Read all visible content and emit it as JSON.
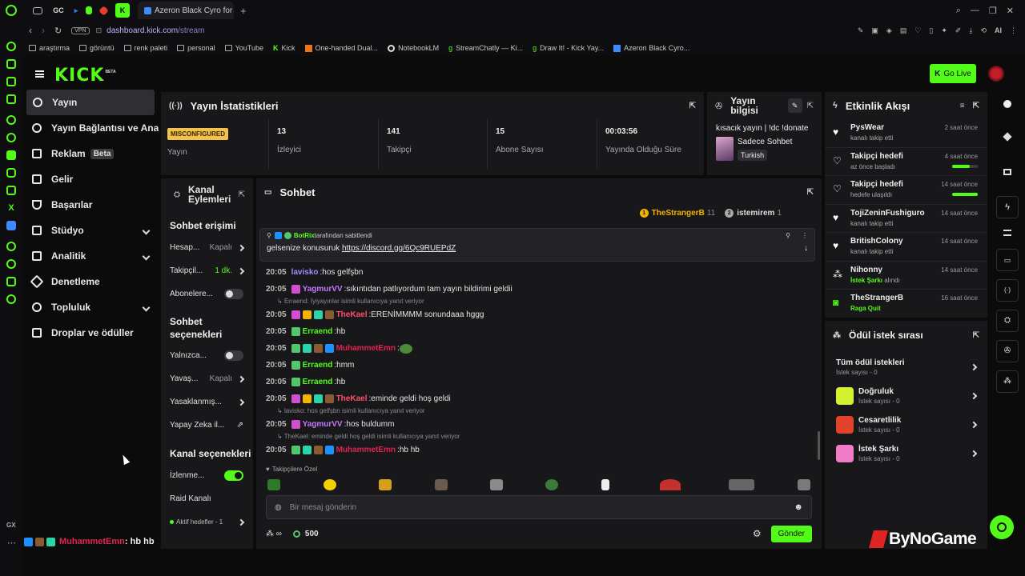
{
  "browser": {
    "tab_title": "Azeron Black Cyro for Lefti",
    "tab_labels": [
      "GC"
    ],
    "vpn": "VPN",
    "url_host": "dashboard.kick.com",
    "url_path": "/stream",
    "ai_label": "AI",
    "bookmarks": [
      "araştırma",
      "görüntü",
      "renk paleti",
      "personal",
      "YouTube",
      "Kick",
      "One-handed Dual...",
      "NotebookLM",
      "StreamChatly — Ki...",
      "Draw It! - Kick Yay...",
      "Azeron Black Cyro..."
    ],
    "gx_label": "GX"
  },
  "header": {
    "logo": "KICK",
    "logo_tag": "BETA",
    "go_live": "Go Live"
  },
  "nav": {
    "items": [
      {
        "label": "Yayın"
      },
      {
        "label": "Yayın Bağlantısı ve Anahtar"
      },
      {
        "label": "Reklam",
        "badge": "Beta"
      },
      {
        "label": "Gelir"
      },
      {
        "label": "Başarılar"
      },
      {
        "label": "Stüdyo"
      },
      {
        "label": "Analitik"
      },
      {
        "label": "Denetleme"
      },
      {
        "label": "Topluluk"
      },
      {
        "label": "Droplar ve ödüller"
      }
    ]
  },
  "stats": {
    "title": "Yayın İstatistikleri",
    "status_badge": "MISCONFIGURED",
    "status_label": "Yayın",
    "cells": [
      {
        "value": "13",
        "label": "İzleyici"
      },
      {
        "value": "141",
        "label": "Takipçi"
      },
      {
        "value": "15",
        "label": "Abone Sayısı"
      },
      {
        "value": "00:03:56",
        "label": "Yayında Olduğu Süre"
      }
    ]
  },
  "info": {
    "title_line1": "Yayın",
    "title_line2": "bilgisi",
    "stream_title": "kısacık yayın | !dc !donate",
    "category": "Sadece Sohbet",
    "language": "Turkish"
  },
  "events": {
    "title": "Etkinlik Akışı",
    "items": [
      {
        "name": "PysWear",
        "desc": "kanalı takip etti",
        "time": "2 saat önce"
      },
      {
        "name": "Takipçi hedefi",
        "desc": "az önce başladı",
        "time": "4 saat önce",
        "progress": 0.7
      },
      {
        "name": "Takipçi hedefi",
        "desc": "hedefe ulaşıldı",
        "time": "14 saat önce",
        "progress": 1.0
      },
      {
        "name": "TojiZeninFushiguro",
        "desc": "kanalı takip etti",
        "time": "14 saat önce"
      },
      {
        "name": "BritishColony",
        "desc": "kanalı takip etti",
        "time": "14 saat önce"
      },
      {
        "name": "Nihonny",
        "desc_highlight": "İstek Şarkı",
        "desc": " alındı",
        "time": "14 saat önce"
      },
      {
        "name": "TheStrangerB",
        "desc": "Raga Quit",
        "time": "16 saat önce"
      }
    ]
  },
  "actions": {
    "title_line1": "Kanal",
    "title_line2": "Eylemleri",
    "chat_access": "Sohbet erişimi",
    "row1": {
      "label": "Hesap...",
      "value": "Kapalı"
    },
    "row2": {
      "label": "Takipçil...",
      "value": "1 dk."
    },
    "row3": {
      "label": "Abonelere..."
    },
    "chat_options_line1": "Sohbet",
    "chat_options_line2": "seçenekleri",
    "row4": {
      "label": "Yalnızca..."
    },
    "row5": {
      "label": "Yavaş...",
      "value": "Kapalı"
    },
    "row6": {
      "label": "Yasaklanmış..."
    },
    "row7": {
      "label": "Yapay Zeka il..."
    },
    "channel_options": "Kanal seçenekleri",
    "row8": {
      "label": "İzlenme..."
    },
    "row9": {
      "label": "Raid Kanalı"
    },
    "row10": {
      "label": "Aktif hedefler - 1"
    }
  },
  "chat": {
    "title": "Sohbet",
    "top_users": [
      {
        "rank": "1",
        "name": "TheStrangerB",
        "count": "11"
      },
      {
        "rank": "2",
        "name": "istemirem",
        "count": "1"
      }
    ],
    "pinned": {
      "by": "BotRix",
      "by_suffix": " tarafından sabitlendi",
      "text": "gelsenize konusuruk ",
      "link": "https://discord.gg/6Qc9RUEPdZ"
    },
    "messages": [
      {
        "time": "20:05",
        "user": "lavisko",
        "color": "#9f8cff",
        "text": "hos gelfşbn",
        "badges": []
      },
      {
        "time": "20:05",
        "user": "YagmurVV",
        "color": "#c477ff",
        "text": "sıkıntıdan patlıyordum tam yayın bildirimi geldii",
        "badges": [
          "#d04fd0"
        ]
      },
      {
        "reply": "Erraend: İyiyayınlar isimli kullanıcıya yanıt veriyor"
      },
      {
        "time": "20:05",
        "user": "TheKael",
        "color": "#ff4f6b",
        "text": "ERENİMMMM sonundaaa hggg",
        "badges": [
          "#d04fd0",
          "#f2b400",
          "#2bd4a6",
          "#8a5a30"
        ]
      },
      {
        "time": "20:05",
        "user": "Erraend",
        "color": "#53fc18",
        "text": "hb",
        "badges": [
          "#53c66b"
        ]
      },
      {
        "time": "20:05",
        "user": "MuhammetEmn",
        "color": "#e0244f",
        "text": "",
        "badges": [
          "#53c66b",
          "#2bd4a6",
          "#8a5a30",
          "#1e90ff"
        ]
      },
      {
        "time": "20:05",
        "user": "Erraend",
        "color": "#53fc18",
        "text": "hmm",
        "badges": [
          "#53c66b"
        ]
      },
      {
        "time": "20:05",
        "user": "Erraend",
        "color": "#53fc18",
        "text": "hb",
        "badges": [
          "#53c66b"
        ]
      },
      {
        "time": "20:05",
        "user": "TheKael",
        "color": "#ff4f6b",
        "text": "eminde geldi hoş geldi",
        "badges": [
          "#d04fd0",
          "#f2b400",
          "#2bd4a6",
          "#8a5a30"
        ]
      },
      {
        "reply": "lavisko: hos gelfşbn isimli kullanıcıya yanıt veriyor"
      },
      {
        "time": "20:05",
        "user": "YagmurVV",
        "color": "#c477ff",
        "text": "hos buldumm",
        "badges": [
          "#d04fd0"
        ]
      },
      {
        "reply": "TheKael: eminde geldi hoş geldi isimli kullanıcıya yanıt veriyor"
      },
      {
        "time": "20:05",
        "user": "MuhammetEmn",
        "color": "#e0244f",
        "text": "hb hb",
        "badges": [
          "#53c66b",
          "#2bd4a6",
          "#8a5a30",
          "#1e90ff"
        ]
      }
    ],
    "followers_only": "Takipçilere Özel",
    "input_placeholder": "Bir mesaj gönderin",
    "points": "500",
    "send": "Gönder"
  },
  "rewards": {
    "title": "Ödül istek sırası",
    "all": {
      "name": "Tüm ödül istekleri",
      "sub": "İstek sayısı - 0"
    },
    "items": [
      {
        "name": "Doğruluk",
        "sub": "İstek sayısı - 0",
        "color": "#d6f032"
      },
      {
        "name": "Cesaretlilik",
        "sub": "İstek sayısı - 0",
        "color": "#e2412b"
      },
      {
        "name": "İstek Şarkı",
        "sub": "İstek sayısı - 0",
        "color": "#f07cc8"
      }
    ]
  },
  "bottom": {
    "user": "MuhammetEmn",
    "text": ": hb hb",
    "watermark": "ByNoGame"
  }
}
